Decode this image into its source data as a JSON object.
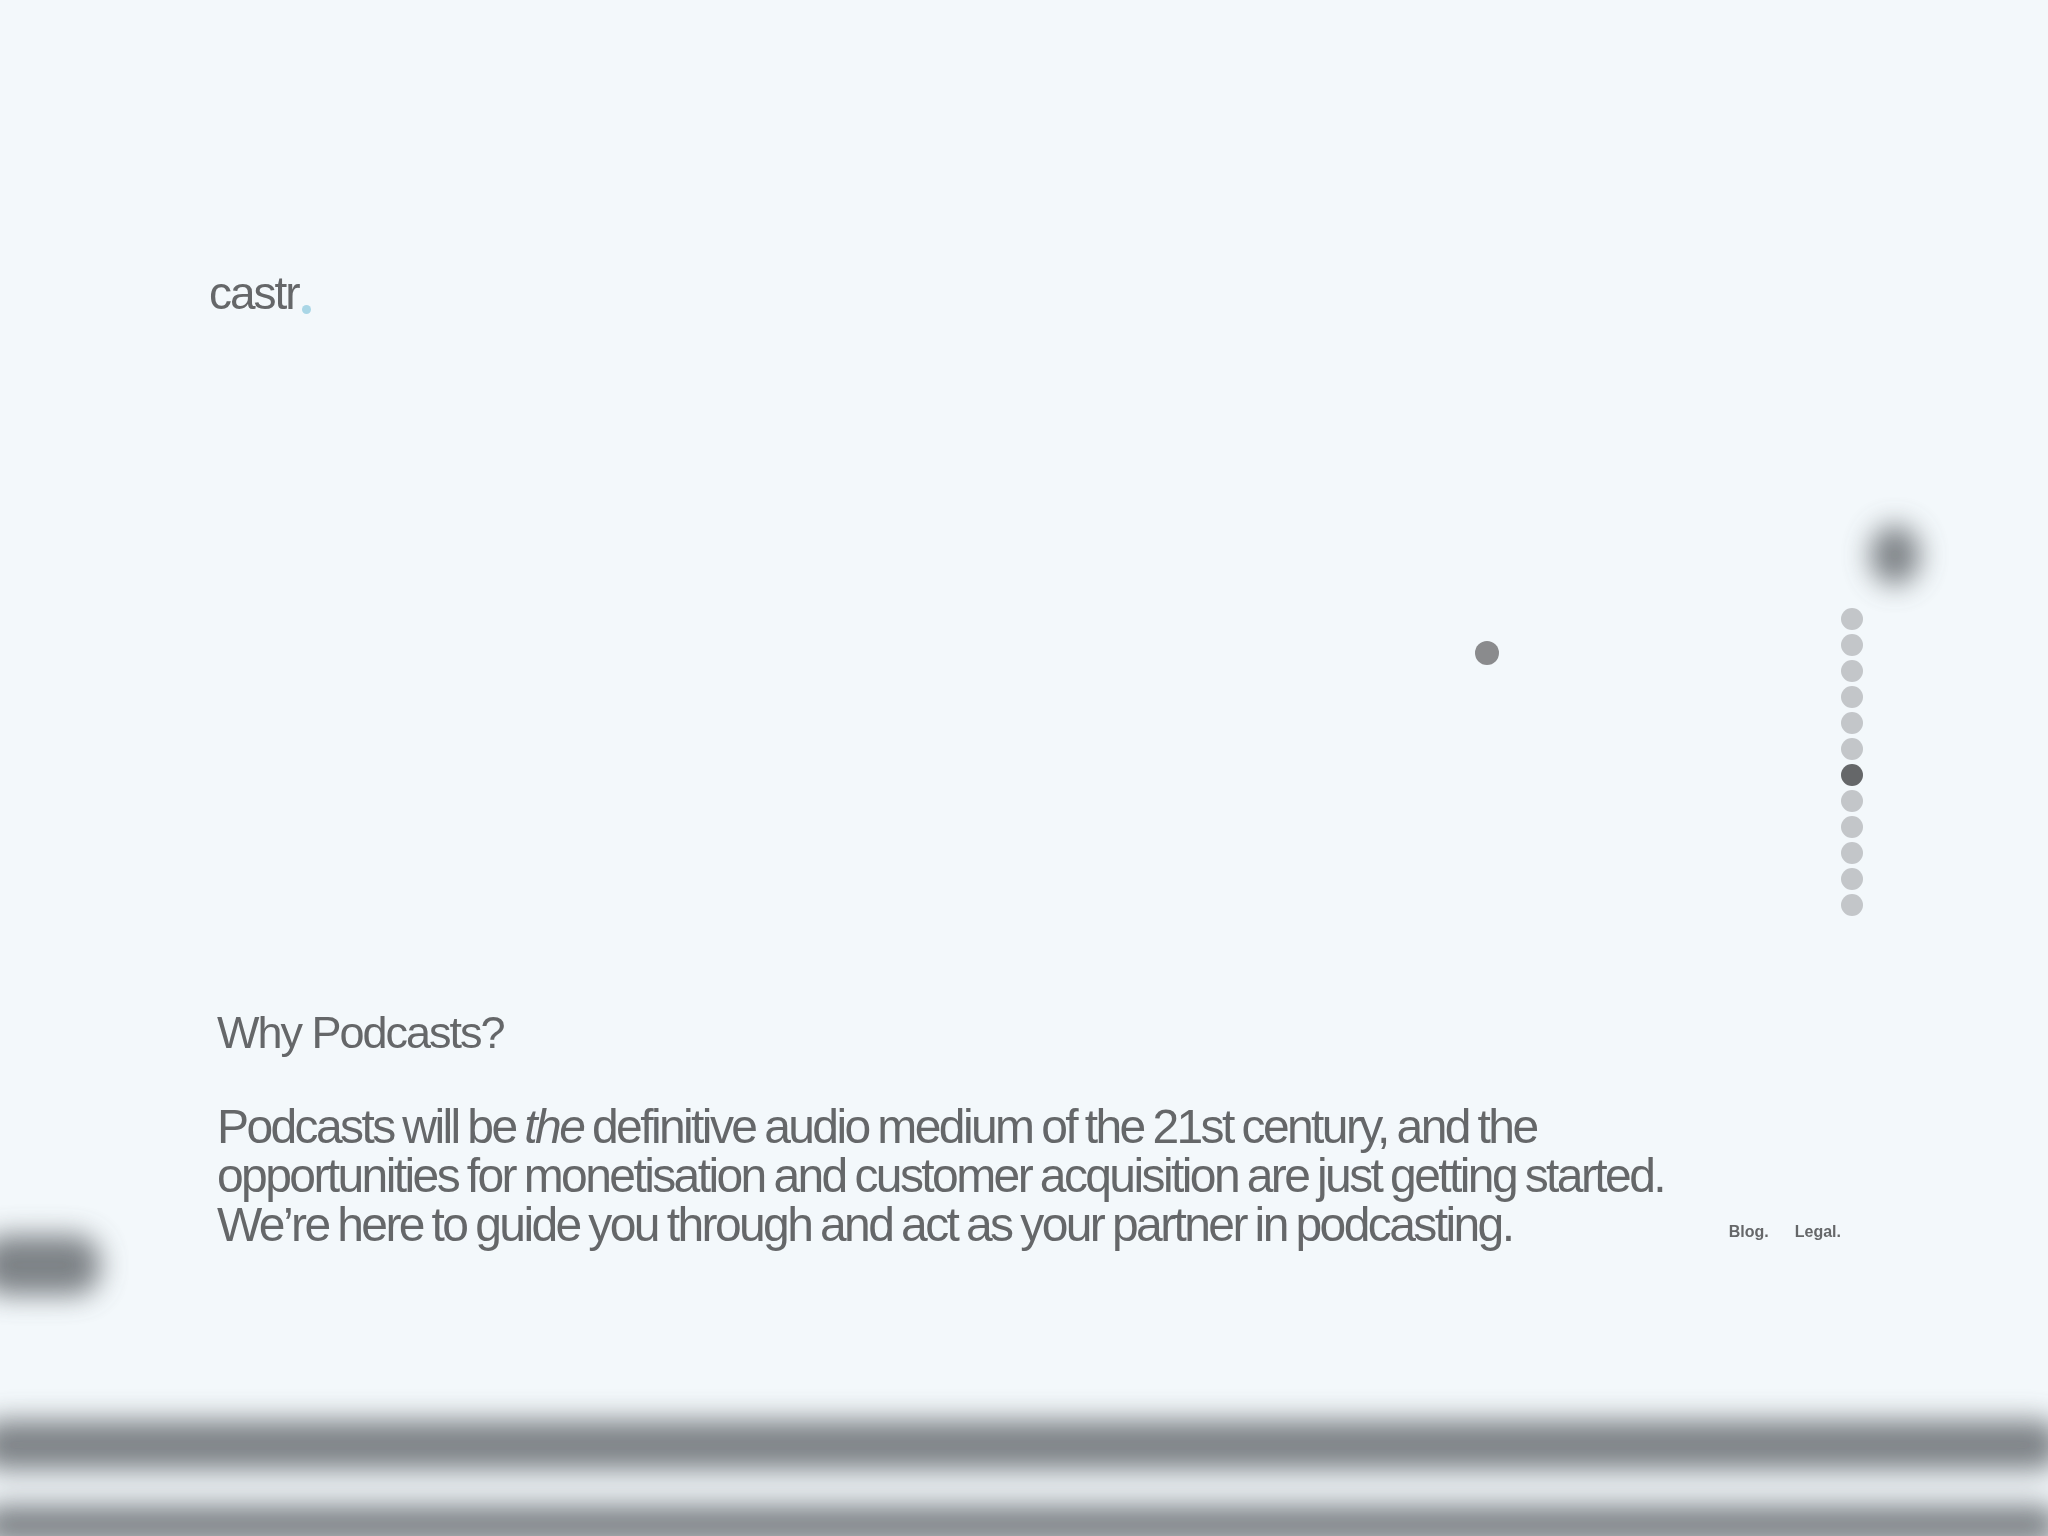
{
  "logo": {
    "text": "castr"
  },
  "slide_nav": [
    {
      "selected": false
    },
    {
      "selected": false
    },
    {
      "selected": false
    },
    {
      "selected": false
    },
    {
      "selected": false
    },
    {
      "selected": false
    },
    {
      "selected": true
    },
    {
      "selected": false
    },
    {
      "selected": false
    },
    {
      "selected": false
    },
    {
      "selected": false
    },
    {
      "selected": false
    }
  ],
  "section": {
    "heading": "Why Podcasts?",
    "body": "Podcasts will be *the* definitive audio medium of the 21st century, and the opportunities for monetisation and customer acquisition are just getting started. We’re here to guide you through and act as your partner in podcasting."
  },
  "footer_links": [
    "Blog.",
    "Legal."
  ]
}
